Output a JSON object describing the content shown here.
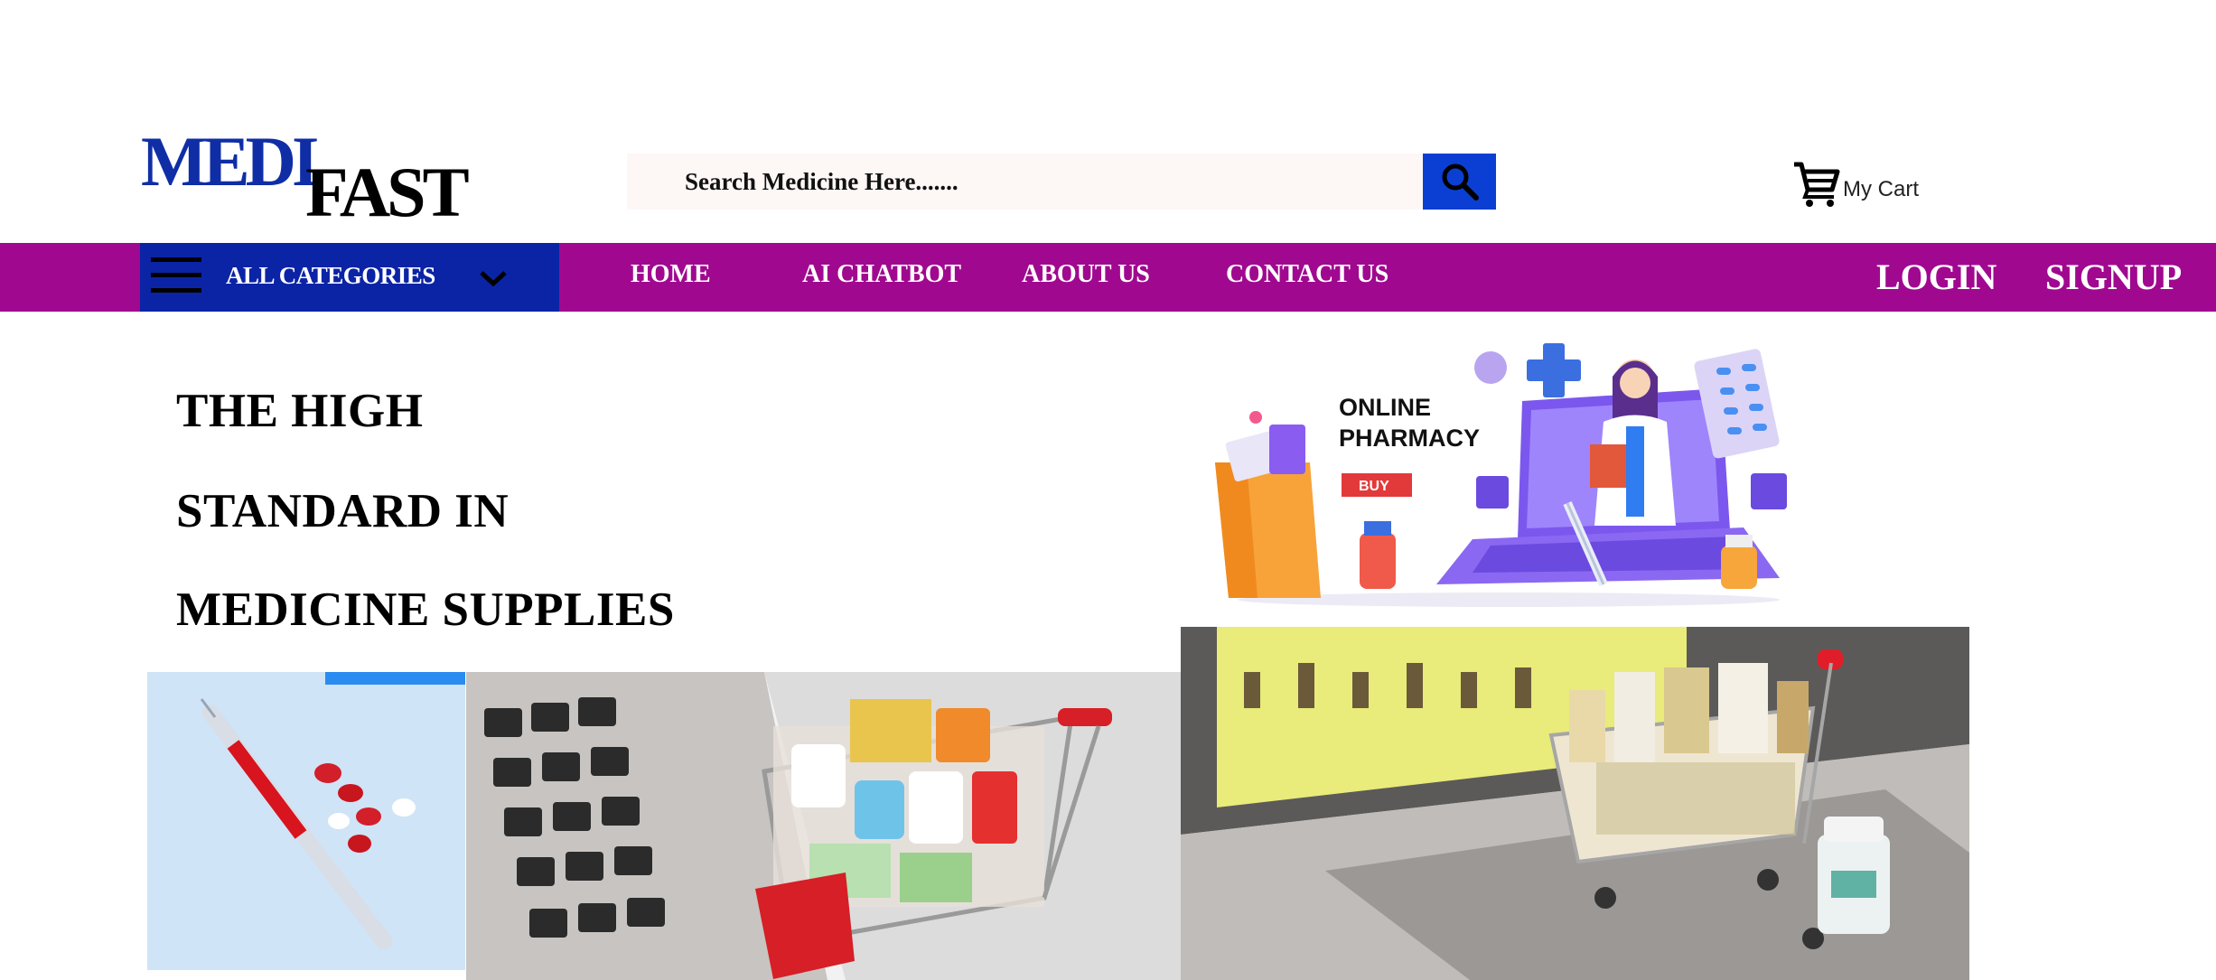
{
  "brand": {
    "part1": "MEDI",
    "part2": "FAST",
    "primary_color": "#0f2ea6"
  },
  "search": {
    "placeholder": "Search Medicine Here.......",
    "button_icon": "search-icon"
  },
  "cart": {
    "label": "My Cart",
    "icon": "cart-icon"
  },
  "nav": {
    "bar_color": "#a0098f",
    "categories": {
      "label": "ALL CATEGORIES",
      "color": "#0b24a6"
    },
    "links": [
      "HOME",
      "AI CHATBOT",
      "ABOUT US",
      "CONTACT US"
    ],
    "login": "LOGIN",
    "signup": "SIGNUP"
  },
  "hero": {
    "lines": [
      "THE HIGH",
      "STANDARD  IN",
      "MEDICINE SUPPLIES"
    ],
    "banner": {
      "title_line1": "ONLINE",
      "title_line2": "PHARMACY",
      "buy": "BUY"
    }
  }
}
